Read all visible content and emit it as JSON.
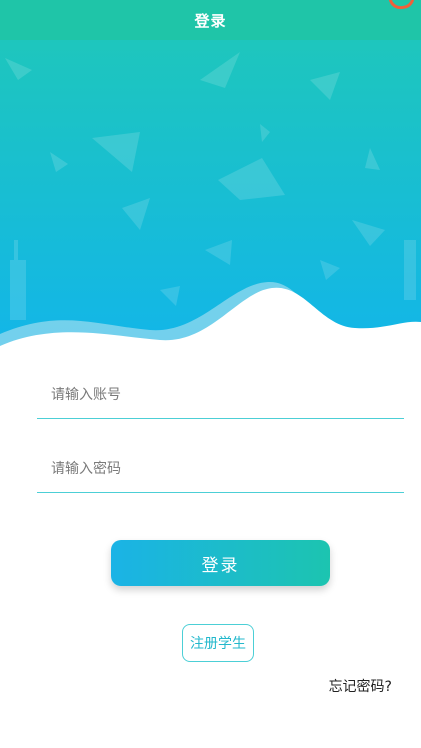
{
  "header": {
    "title": "登录"
  },
  "form": {
    "account_placeholder": "请输入账号",
    "password_placeholder": "请输入密码"
  },
  "actions": {
    "login_label": "登录",
    "register_label": "注册学生",
    "forgot_label": "忘记密码?"
  },
  "colors": {
    "header_bg": "#1fc5a8",
    "hero_top": "#1ec6bd",
    "hero_bottom": "#12b5ea",
    "accent_line": "#4ccfd6"
  }
}
